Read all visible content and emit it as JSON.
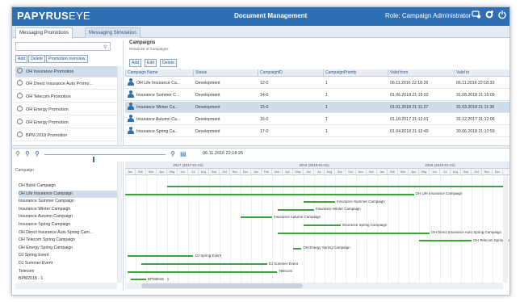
{
  "header": {
    "logo": "PAPYRUS",
    "logo_eye": "EYE",
    "title": "Document Management",
    "role": "Role: Campaign Administrator",
    "accent": "#2d6fb0"
  },
  "tabs": [
    {
      "label": "Messaging Promotions",
      "active": true
    },
    {
      "label": "Messaging Simulation",
      "active": false
    }
  ],
  "left_panel": {
    "search_placeholder": "",
    "buttons": [
      "Add",
      "Delete",
      "Promotion overview"
    ],
    "items": [
      {
        "label": "OH Insurance Promotion",
        "selected": true
      },
      {
        "label": "OH Direct Insurance Auto Promo...",
        "selected": false
      },
      {
        "label": "OH Telecom Promotion",
        "selected": false
      },
      {
        "label": "OH Energy Promotion",
        "selected": false
      },
      {
        "label": "OH Energy Promotion",
        "selected": false
      },
      {
        "label": "BPM 2018 Promotion",
        "selected": false
      }
    ]
  },
  "campaigns": {
    "title": "Campaigns",
    "subtitle": "Result list of Campaigns",
    "buttons": [
      "Add",
      "Edit",
      "Delete"
    ],
    "columns": [
      "Campaign Name",
      "Status",
      "CampaignID",
      "CampaignPriority",
      "Valid from",
      "Valid to"
    ],
    "rows": [
      {
        "name": "OH Life Insurance Ca...",
        "status": "Development",
        "id": "12-0",
        "priority": "1",
        "from": "06.11.2016 22:18:26",
        "to": "06.11.2016 22:18:33",
        "selected": false
      },
      {
        "name": "Insurance Summer C...",
        "status": "Development",
        "id": "14-0",
        "priority": "1",
        "from": "01.06.2018 21:15:02",
        "to": "31.08.2018 21:15:09",
        "selected": false
      },
      {
        "name": "Insurance Winter Ca...",
        "status": "Development",
        "id": "15-0",
        "priority": "1",
        "from": "01.01.2018 21:11:27",
        "to": "31.03.2018 21:11:36",
        "selected": true
      },
      {
        "name": "Insurance Autumn Ca...",
        "status": "Development",
        "id": "16-0",
        "priority": "1",
        "from": "01.10.2017 21:12:01",
        "to": "31.12.2017 21:12:06",
        "selected": false
      },
      {
        "name": "Insurance Spring Ca...",
        "status": "Development",
        "id": "17-0",
        "priority": "1",
        "from": "01.04.2018 21:12:49",
        "to": "30.06.2018 21:12:59",
        "selected": false
      }
    ]
  },
  "gantt": {
    "date": "06.11.2016 22:18:26",
    "label_header": "Campaign",
    "years": [
      "2017 (2017-01-01)",
      "2018 (2018-01-01)",
      "2019 (2019-01-01)"
    ],
    "months": [
      "Jan",
      "Feb",
      "Mar",
      "Apr",
      "May",
      "Jun",
      "Jul",
      "Aug",
      "Sep",
      "Oct",
      "Nov",
      "Dec",
      "Jan",
      "Feb",
      "Mar",
      "Apr",
      "May",
      "Jun",
      "Jul",
      "Aug",
      "Sep",
      "Oct",
      "Nov",
      "Dec",
      "Jan",
      "Feb",
      "Mar",
      "Apr",
      "May",
      "Jun",
      "Jul",
      "Aug",
      "Sep",
      "Oct",
      "Nov",
      "Dec"
    ],
    "rows": [
      {
        "label": "OH Bank Campaign",
        "bar": "",
        "start": 4,
        "end": 36,
        "selected": false
      },
      {
        "label": "OH Life Insurance Campaign",
        "bar": "OH Life Insurance Campaign",
        "start": 0,
        "end": 27.5,
        "selected": true
      },
      {
        "label": "Insurance Summer Campaign",
        "bar": "Insurance Summer Campaign",
        "start": 17,
        "end": 20,
        "selected": false
      },
      {
        "label": "Insurance Winter Campaign",
        "bar": "Insurance Winter Campaign",
        "start": 14.5,
        "end": 18,
        "selected": false
      },
      {
        "label": "Insurance Autumn Campaign",
        "bar": "Insurance Autumn Campaign",
        "start": 11,
        "end": 14,
        "selected": false
      },
      {
        "label": "Insurance Spring Campaign",
        "bar": "Insurance Spring Campaign",
        "start": 17,
        "end": 20.5,
        "selected": false
      },
      {
        "label": "OH Direct Insurance Auto Spring Cam...",
        "bar": "OH Direct Insurance Auto Spring Campaign",
        "start": 14.5,
        "end": 29,
        "selected": false
      },
      {
        "label": "OH Telecom Spring Campaign",
        "bar": "OH Telecom Spring Campaign",
        "start": 28,
        "end": 33,
        "selected": false
      },
      {
        "label": "OH Energy Spring Campaign",
        "bar": "OH Energy Spring Campaign",
        "start": 16,
        "end": 16.8,
        "selected": false
      },
      {
        "label": "DJ Spring Event",
        "bar": "DJ Spring Event",
        "start": 0.2,
        "end": 6.5,
        "selected": false
      },
      {
        "label": "DJ Summer Event",
        "bar": "DJ Summer Event",
        "start": 1.5,
        "end": 13.5,
        "selected": false
      },
      {
        "label": "Telecom",
        "bar": "Telecom",
        "start": 0.2,
        "end": 14.5,
        "selected": false
      },
      {
        "label": "BPM2018 - 1",
        "bar": "BPM2018 - 1",
        "start": 0.5,
        "end": 2,
        "selected": false
      }
    ]
  }
}
